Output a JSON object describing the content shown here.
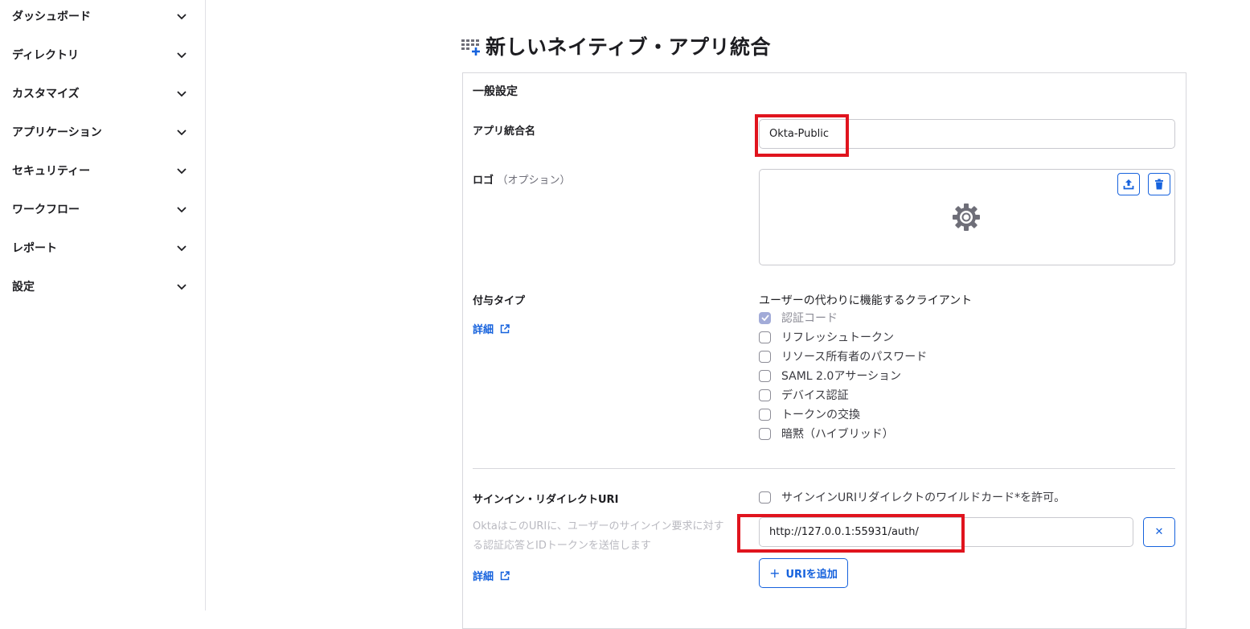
{
  "sidebar": {
    "items": [
      {
        "label": "ダッシュボード"
      },
      {
        "label": "ディレクトリ"
      },
      {
        "label": "カスタマイズ"
      },
      {
        "label": "アプリケーション"
      },
      {
        "label": "セキュリティー"
      },
      {
        "label": "ワークフロー"
      },
      {
        "label": "レポート"
      },
      {
        "label": "設定"
      }
    ]
  },
  "page": {
    "title": "新しいネイティブ・アプリ統合"
  },
  "general": {
    "section_title": "一般設定",
    "app_name_label": "アプリ統合名",
    "app_name_value": "Okta-Public",
    "logo_label": "ロゴ",
    "logo_optional": "（オプション）",
    "grant_label": "付与タイプ",
    "details_link": "詳細",
    "grant_heading": "ユーザーの代わりに機能するクライアント",
    "grants": [
      {
        "label": "認証コード",
        "checked": true,
        "disabled": true
      },
      {
        "label": "リフレッシュトークン",
        "checked": false
      },
      {
        "label": "リソース所有者のパスワード",
        "checked": false
      },
      {
        "label": "SAML 2.0アサーション",
        "checked": false
      },
      {
        "label": "デバイス認証",
        "checked": false
      },
      {
        "label": "トークンの交換",
        "checked": false
      },
      {
        "label": "暗黙（ハイブリッド）",
        "checked": false
      }
    ]
  },
  "signin": {
    "label": "サインイン・リダイレクトURI",
    "wildcard_label": "サインインURIリダイレクトのワイルドカード*を許可。",
    "help_text": "OktaはこのURIに、ユーザーのサインイン要求に対する認証応答とIDトークンを送信します",
    "details_link": "詳細",
    "uri_value": "http://127.0.0.1:55931/auth/",
    "add_uri_label": "URIを追加",
    "add_uri_plus": "+",
    "remove_glyph": "✕"
  },
  "colors": {
    "accent": "#1662dd",
    "highlight": "#e0141e",
    "checked_box": "#a2abd8"
  }
}
